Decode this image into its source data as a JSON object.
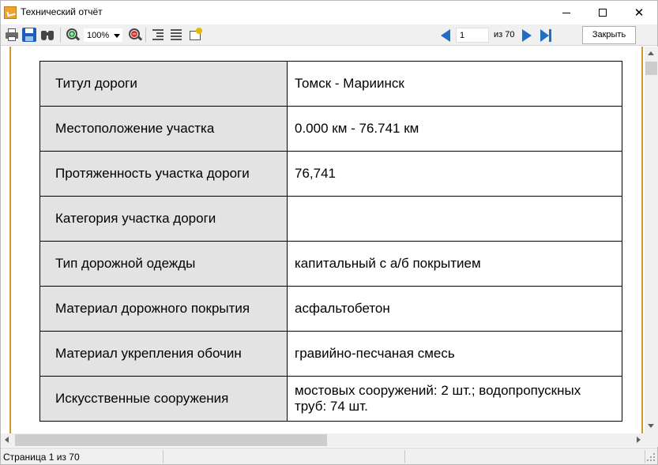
{
  "window": {
    "title": "Технический отчёт",
    "minimize_icon": "minimize-icon",
    "maximize_icon": "maximize-icon",
    "close_glyph": "✕"
  },
  "toolbar": {
    "zoom_value": "100%",
    "page_current": "1",
    "page_of": "из 70",
    "close_label": "Закрыть",
    "icons": [
      "print-icon",
      "save-icon",
      "find-icon",
      "zoom-in-icon",
      "zoom-out-icon",
      "tree-icon",
      "list-icon",
      "parameters-icon",
      "first-page-icon",
      "next-page-icon",
      "last-page-icon"
    ]
  },
  "report": {
    "rows": [
      {
        "label": "Титул дороги",
        "value": "Томск - Мариинск"
      },
      {
        "label": "Местоположение участка",
        "value": "0.000 км - 76.741 км"
      },
      {
        "label": "Протяженность участка дороги",
        "value": "76,741"
      },
      {
        "label": "Категория участка дороги",
        "value": ""
      },
      {
        "label": "Тип дорожной одежды",
        "value": "капитальный с а/б покрытием"
      },
      {
        "label": "Материал дорожного покрытия",
        "value": "асфальтобетон"
      },
      {
        "label": "Материал укрепления обочин",
        "value": "гравийно-песчаная смесь"
      },
      {
        "label": "Искусственные сооружения",
        "value": "мостовых сооружений: 2 шт.; водопропускных труб: 74 шт."
      }
    ]
  },
  "status": {
    "page_text": "Страница 1 из 70"
  },
  "colors": {
    "page_edge": "#d29a25",
    "nav_arrow": "#1f6ec6",
    "label_cell_bg": "#e3e3e3"
  }
}
